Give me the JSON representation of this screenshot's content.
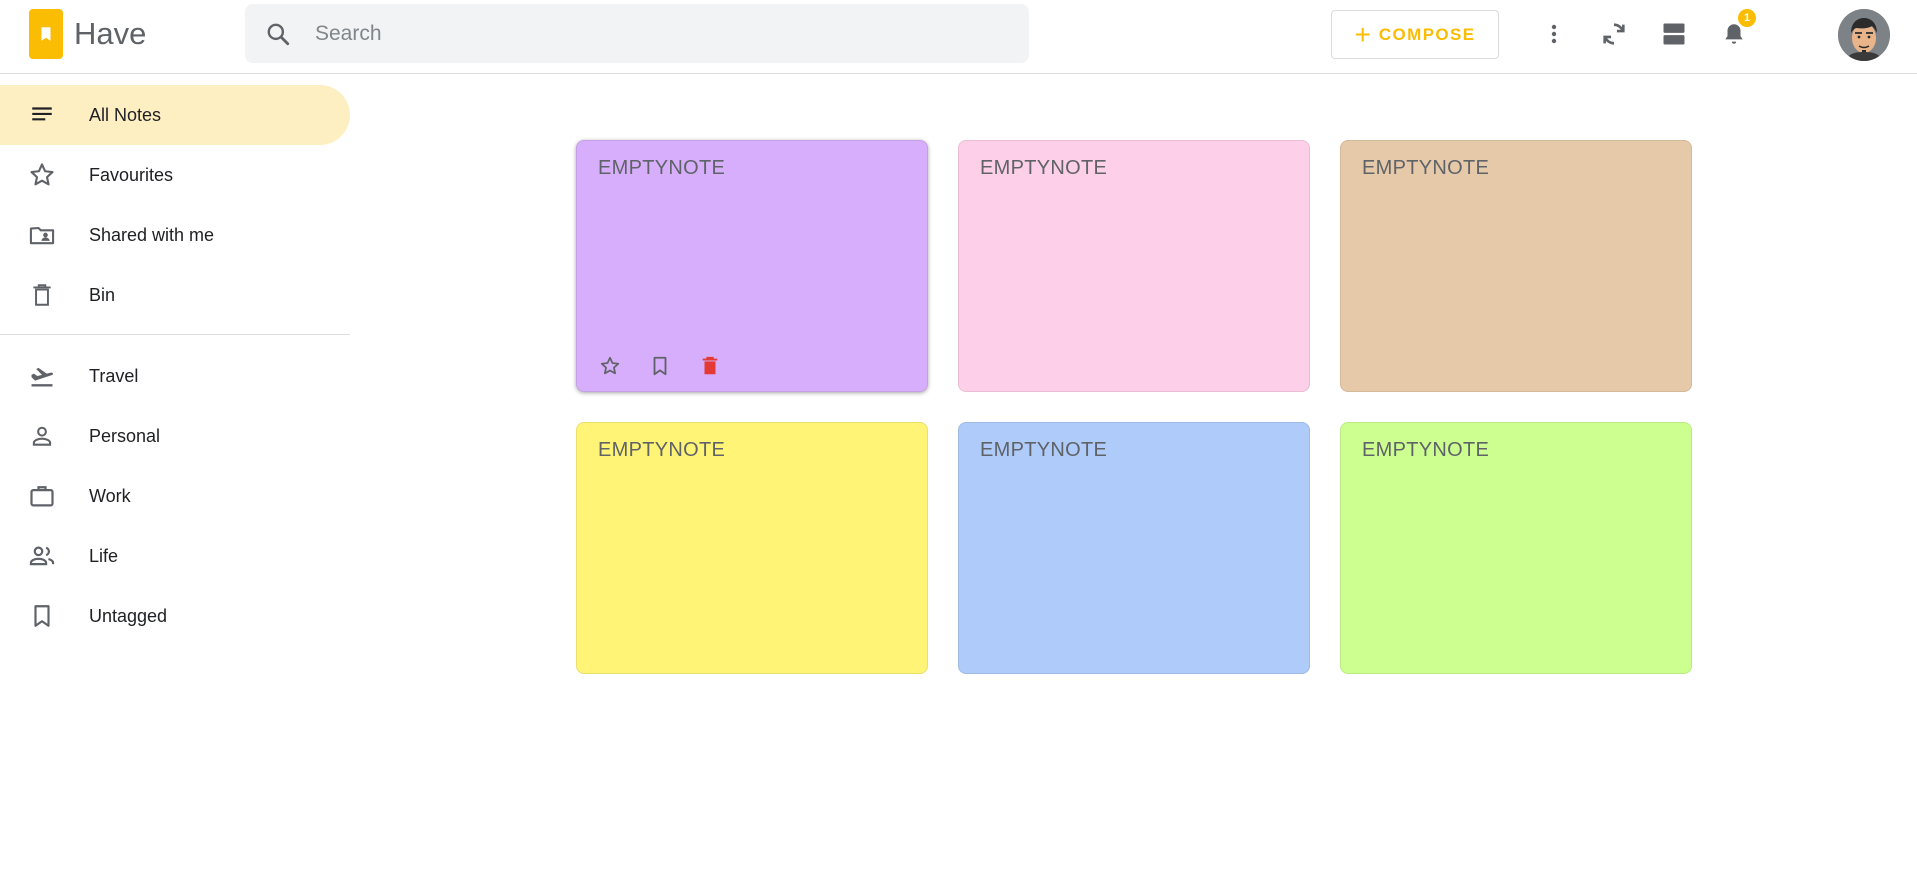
{
  "header": {
    "app_title": "Have",
    "logo_icon": "bookmark-note-icon",
    "search": {
      "placeholder": "Search",
      "value": "",
      "icon": "search-icon"
    },
    "compose": {
      "icon": "plus-icon",
      "label": "COMPOSE"
    },
    "icons": [
      "more-vert-icon",
      "sync-icon",
      "view-agenda-icon",
      "bell-icon"
    ],
    "notification_count": "1",
    "avatar_icon": "user-avatar"
  },
  "sidebar": {
    "items": [
      {
        "label": "All Notes",
        "icon": "notes-lines-icon",
        "active": true
      },
      {
        "label": "Favourites",
        "icon": "star-outline-icon"
      },
      {
        "label": "Shared with me",
        "icon": "shared-folder-icon"
      },
      {
        "label": "Bin",
        "icon": "trash-icon"
      }
    ],
    "tags": [
      {
        "label": "Travel",
        "icon": "plane-icon"
      },
      {
        "label": "Personal",
        "icon": "person-icon"
      },
      {
        "label": "Work",
        "icon": "briefcase-icon"
      },
      {
        "label": "Life",
        "icon": "people-icon"
      },
      {
        "label": "Untagged",
        "icon": "bookmark-outline-icon"
      }
    ]
  },
  "notes": [
    {
      "title": "EMPTYNOTE",
      "color": "#d7aefb",
      "hovered": true
    },
    {
      "title": "EMPTYNOTE",
      "color": "#fdcfe8"
    },
    {
      "title": "EMPTYNOTE",
      "color": "#e6c9a8"
    },
    {
      "title": "EMPTYNOTE",
      "color": "#fff475"
    },
    {
      "title": "EMPTYNOTE",
      "color": "#aecbfa"
    },
    {
      "title": "EMPTYNOTE",
      "color": "#ccff90"
    }
  ],
  "note_actions": [
    "star-outline-icon",
    "bookmark-outline-icon",
    "delete-icon"
  ],
  "colors": {
    "accent": "#fbbc04",
    "active_nav": "#feefc3",
    "delete": "#e53935"
  }
}
